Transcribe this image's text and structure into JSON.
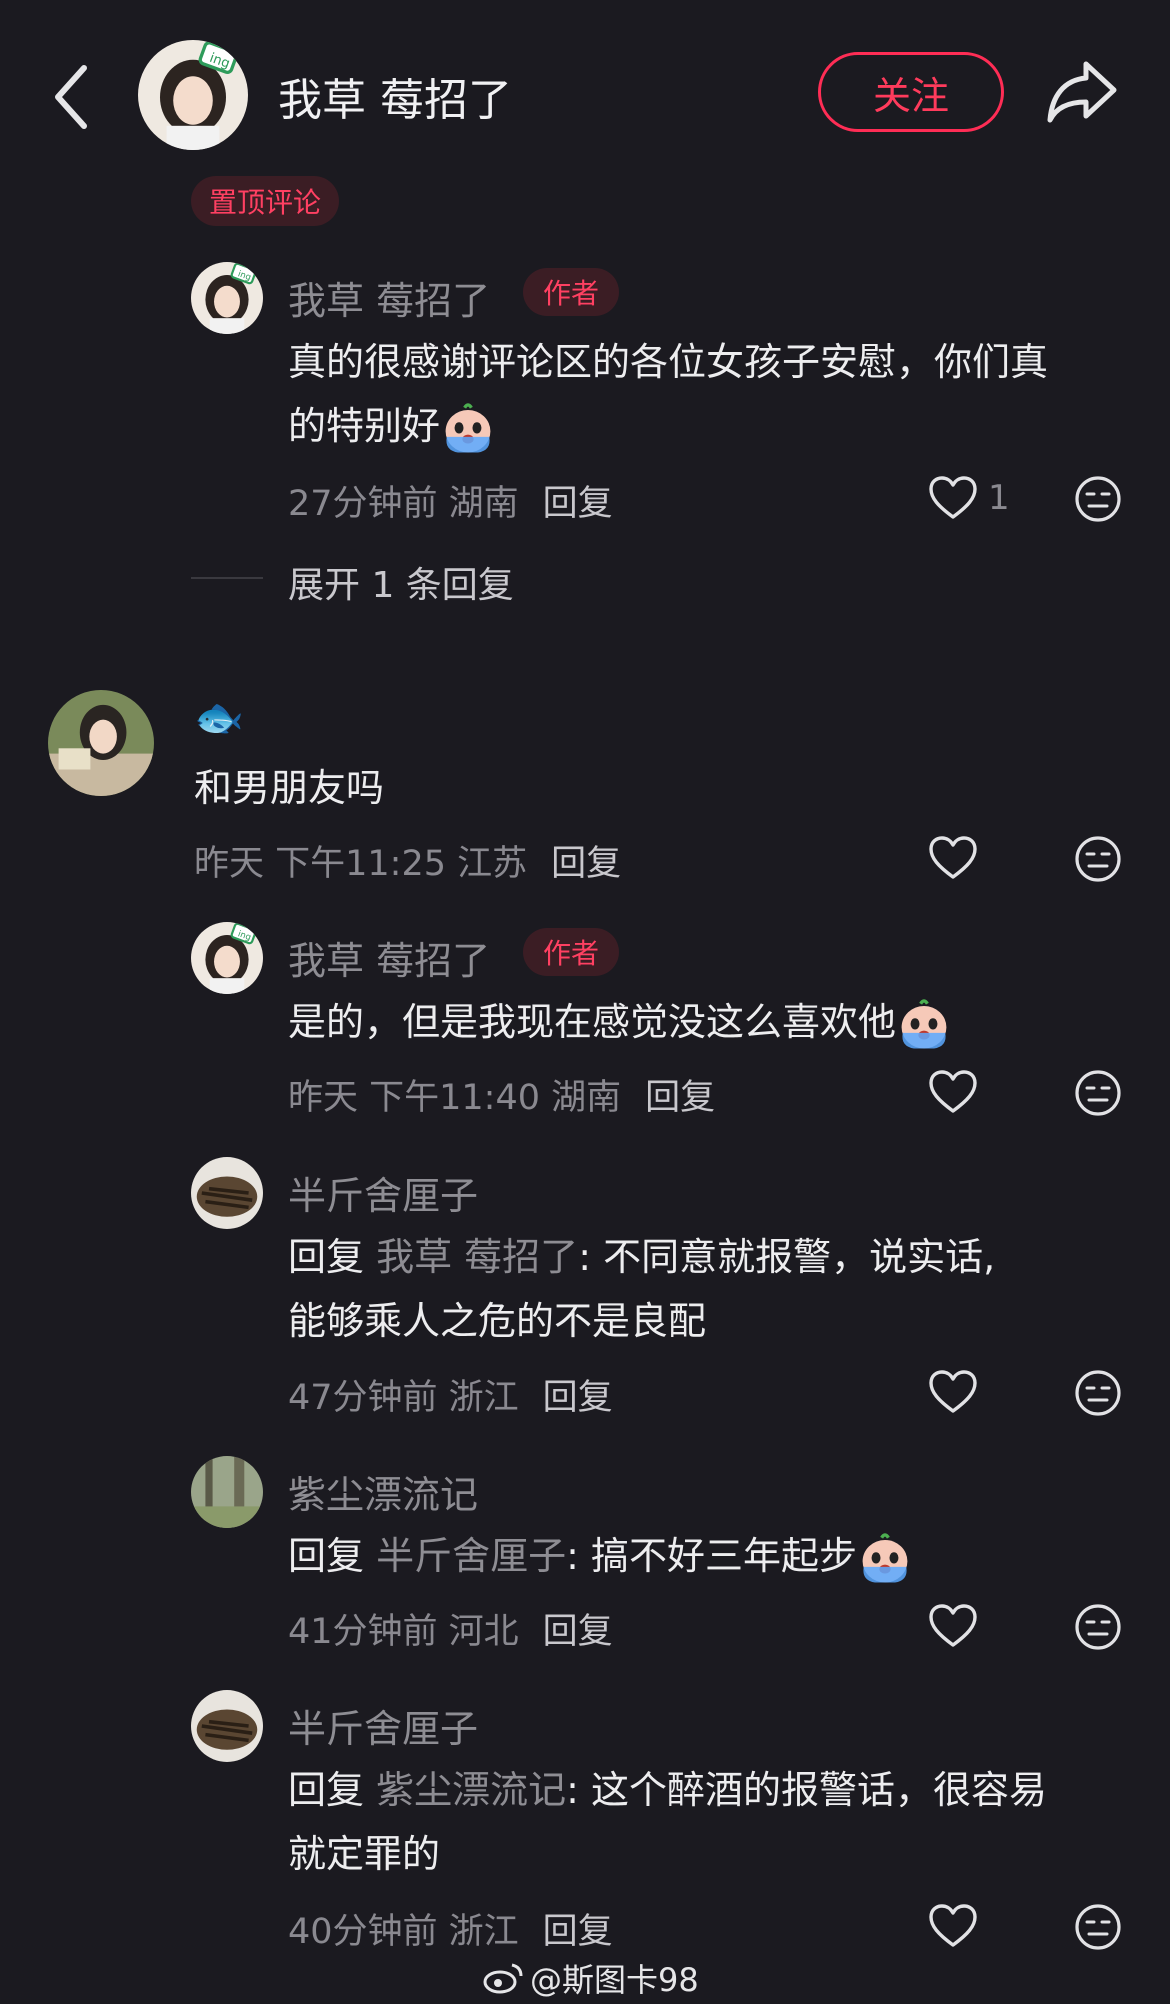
{
  "header": {
    "title": "我草 莓招了",
    "follow_label": "关注"
  },
  "pinned_label": "置顶评论",
  "author_badge": "作者",
  "comments": [
    {
      "user": "我草 莓招了",
      "text": "真的很感谢评论区的各位女孩子安慰，你们真",
      "text2": "的特别好",
      "time": "27分钟前 湖南",
      "reply": "回复",
      "likes": "1",
      "expand": "展开 1 条回复"
    },
    {
      "user": "🐟",
      "text": "和男朋友吗",
      "time": "昨天 下午11:25 江苏",
      "reply": "回复"
    },
    {
      "user": "我草 莓招了",
      "text": "是的，但是我现在感觉没这么喜欢他",
      "time": "昨天 下午11:40 湖南",
      "reply": "回复"
    },
    {
      "user": "半斤舍厘子",
      "reply_prefix": "回复 ",
      "mention": "我草 莓招了",
      "text": ": 不同意就报警，说实话,",
      "text2": "能够乘人之危的不是良配",
      "time": "47分钟前 浙江",
      "reply": "回复"
    },
    {
      "user": "紫尘漂流记",
      "reply_prefix": "回复 ",
      "mention": "半斤舍厘子",
      "text": ": 搞不好三年起步",
      "time": "41分钟前 河北",
      "reply": "回复"
    },
    {
      "user": "半斤舍厘子",
      "reply_prefix": "回复 ",
      "mention": "紫尘漂流记",
      "text": ": 这个醉酒的报警话，很容易",
      "text2": "就定罪的",
      "time": "40分钟前 浙江",
      "reply": "回复"
    }
  ],
  "watermark": "@斯图卡98",
  "colors": {
    "background": "#1b1a20",
    "accent": "#ff2d55",
    "muted": "#8e8d93"
  },
  "icons": [
    "back-icon",
    "share-icon",
    "heart-icon",
    "neutral-face-icon",
    "crying-emoji-icon",
    "weibo-icon"
  ]
}
